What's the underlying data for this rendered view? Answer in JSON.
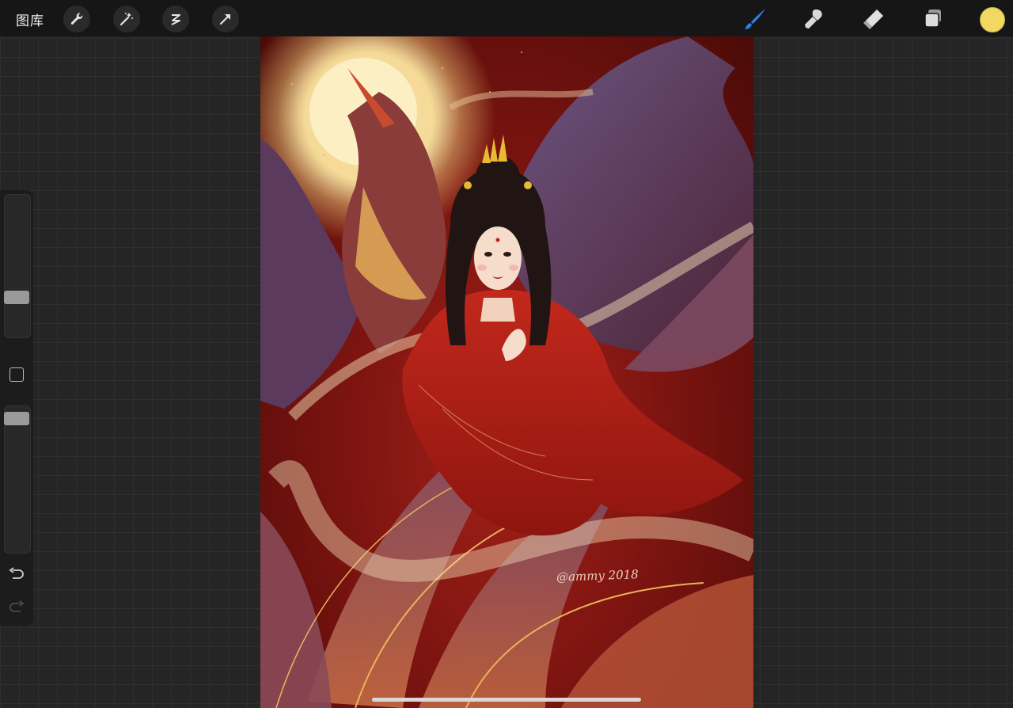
{
  "toolbar": {
    "gallery_label": "图库",
    "left_tools": [
      "wrench-icon",
      "magic-wand-icon",
      "selection-icon",
      "transform-arrow-icon"
    ],
    "right_tools": [
      "brush-icon",
      "smudge-icon",
      "eraser-icon",
      "layers-icon"
    ],
    "active_tool": "brush-icon",
    "accent_color": "#2f7fe8",
    "current_color": "#f2d862"
  },
  "sidebar": {
    "brush_size_level": 0.25,
    "opacity_level": 0.95,
    "controls": [
      "modify-button",
      "undo-icon",
      "redo-icon"
    ]
  },
  "canvas": {
    "signature": "@ammy 2018",
    "colors": {
      "background_red": "#8a1712",
      "moon": "#fbecc0",
      "phoenix_purple": "#5a3a62",
      "gold": "#e9b35a"
    }
  }
}
